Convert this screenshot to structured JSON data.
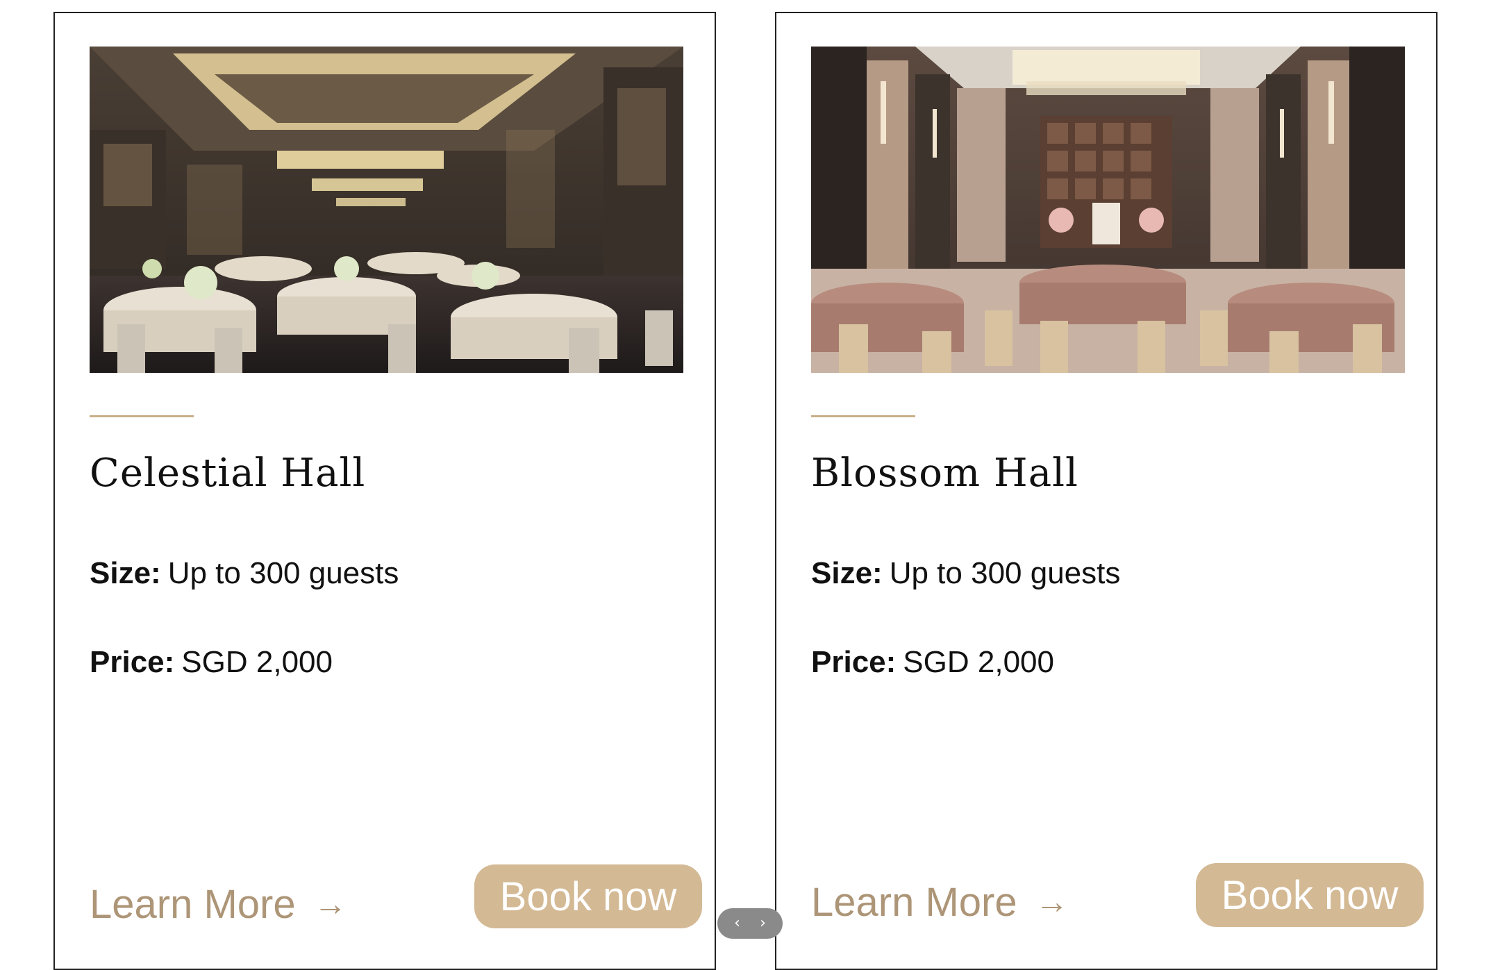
{
  "theme": {
    "accent": "#d3b994",
    "accent_text": "#ad9577",
    "divider": "#c9ae8a"
  },
  "cards": [
    {
      "title": "Celestial Hall",
      "size_label": "Size:",
      "size_value": "Up to 300 guests",
      "price_label": "Price:",
      "price_value": "SGD 2,000",
      "learn_more": "Learn More",
      "book_now": "Book now"
    },
    {
      "title": "Blossom Hall",
      "size_label": "Size:",
      "size_value": "Up to 300 guests",
      "price_label": "Price:",
      "price_value": "SGD 2,000",
      "learn_more": "Learn More",
      "book_now": "Book now"
    }
  ],
  "carousel": {
    "prev_icon": "chevron-left-icon",
    "next_icon": "chevron-right-icon"
  }
}
